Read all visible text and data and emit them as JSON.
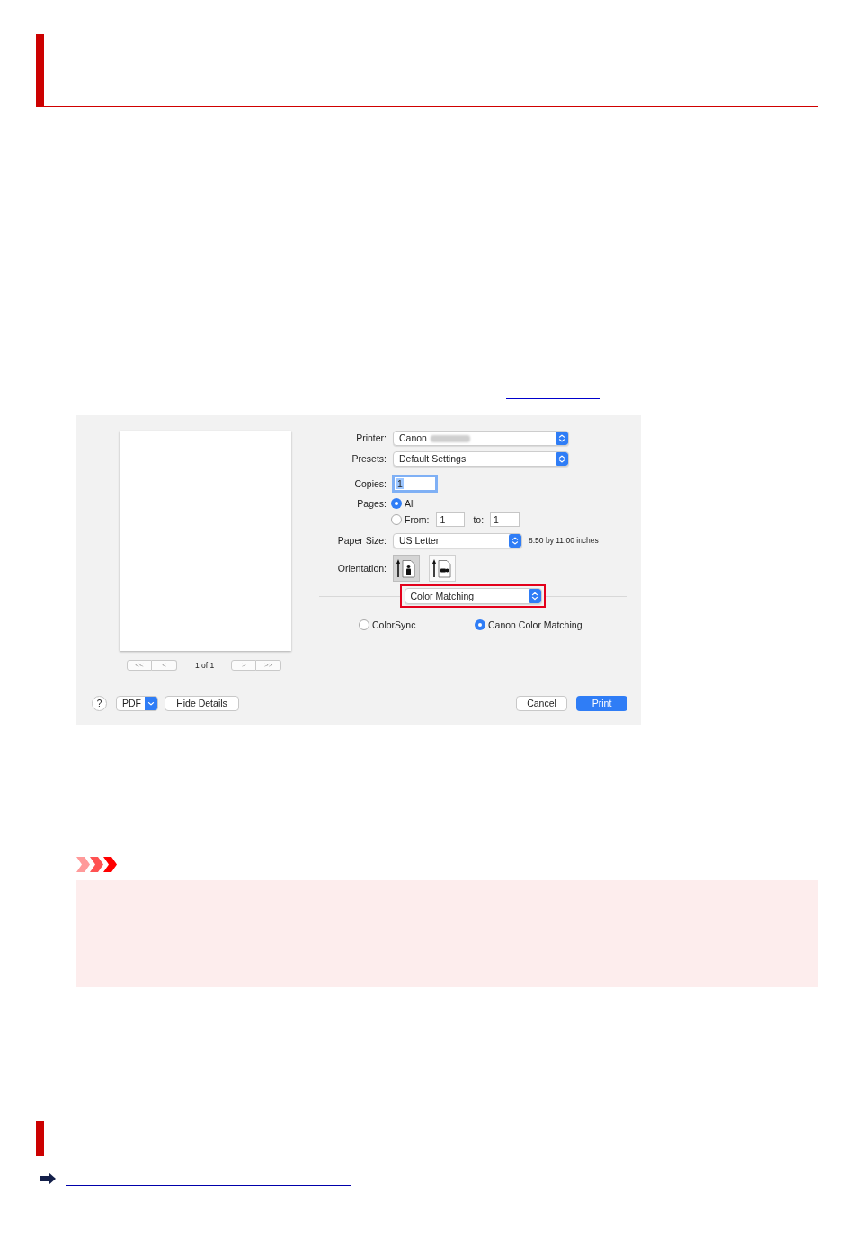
{
  "print_dialog": {
    "preview": {
      "nav_buttons": [
        "<<",
        "<",
        ">",
        ">>"
      ],
      "page_counter": "1 of 1"
    },
    "fields": [
      {
        "kind": "popup",
        "label": "Printer:",
        "value": "Canon",
        "redacted": true
      },
      {
        "kind": "popup",
        "label": "Presets:",
        "value": "Default Settings"
      },
      {
        "kind": "text",
        "label": "Copies:",
        "value": "1",
        "focused": true
      },
      {
        "kind": "pages",
        "label": "Pages:",
        "options": [
          {
            "label": "All",
            "selected": true
          },
          {
            "label": "From:",
            "selected": false
          }
        ],
        "from": "1",
        "to_label": "to:",
        "to": "1"
      },
      {
        "kind": "popup",
        "label": "Paper Size:",
        "value": "US Letter",
        "note": "8.50 by 11.00 inches"
      },
      {
        "kind": "orientation",
        "label": "Orientation:",
        "options": [
          {
            "kind": "portrait",
            "selected": true
          },
          {
            "kind": "landscape",
            "selected": false
          }
        ]
      }
    ],
    "panel_menu": {
      "value": "Color Matching",
      "highlighted": true
    },
    "color_options": [
      {
        "label": "ColorSync",
        "selected": false
      },
      {
        "label": "Canon Color Matching",
        "selected": true
      }
    ],
    "footer": {
      "help": "?",
      "pdf": "PDF",
      "hide_details": "Hide Details",
      "cancel": "Cancel",
      "print": "Print"
    }
  }
}
